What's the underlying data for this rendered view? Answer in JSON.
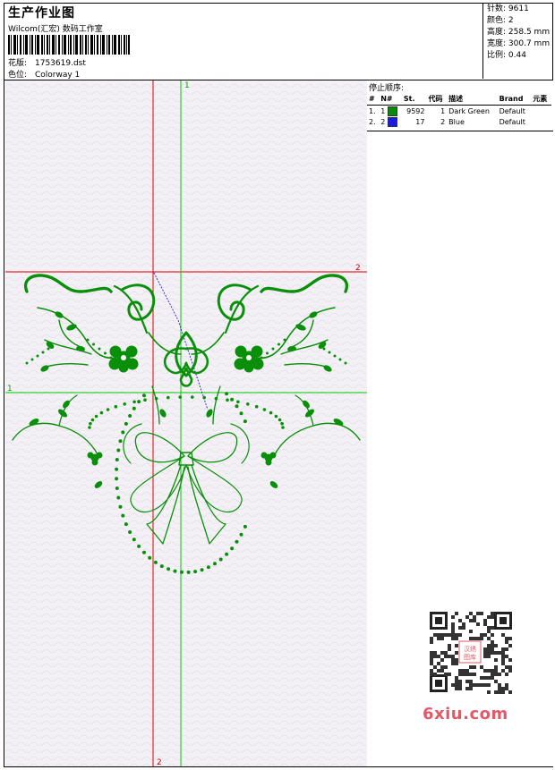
{
  "header": {
    "title": "生产作业图",
    "subtitle": "Wilcom(汇宏) 数码工作室",
    "design_label": "花版:",
    "design_file": "1753619.dst",
    "color_label": "色位:",
    "colorway": "Colorway 1"
  },
  "stats": {
    "stitches_label": "针数:",
    "stitches": "9611",
    "colors_label": "颜色:",
    "colors": "2",
    "height_label": "高度:",
    "height": "258.5 mm",
    "width_label": "宽度:",
    "width": "300.7 mm",
    "scale_label": "比例:",
    "scale": "0.44"
  },
  "stop_sequence": {
    "heading": "停止顺序:",
    "columns": [
      "#",
      "N#",
      "St.",
      "代码",
      "描述",
      "Brand",
      "元素"
    ],
    "rows": [
      {
        "index": "1.",
        "needle": "1",
        "color": "#0a8a0a",
        "stitches": "9592",
        "code": "1",
        "description": "Dark Green",
        "brand": "Default"
      },
      {
        "index": "2.",
        "needle": "2",
        "color": "#1a1ae0",
        "stitches": "17",
        "code": "2",
        "description": "Blue",
        "brand": "Default"
      }
    ]
  },
  "guides": {
    "green_v_label": "1",
    "green_h_label": "1",
    "red_h_label": "2",
    "red_v_label": "2"
  },
  "watermark": {
    "site": "6xiu.com",
    "stamp": "汉绣图库"
  },
  "colors": {
    "embroidery": "#0a8f0a",
    "guide_red": "#e00000",
    "guide_green": "#00cc00",
    "connector_blue": "#2020d0"
  }
}
